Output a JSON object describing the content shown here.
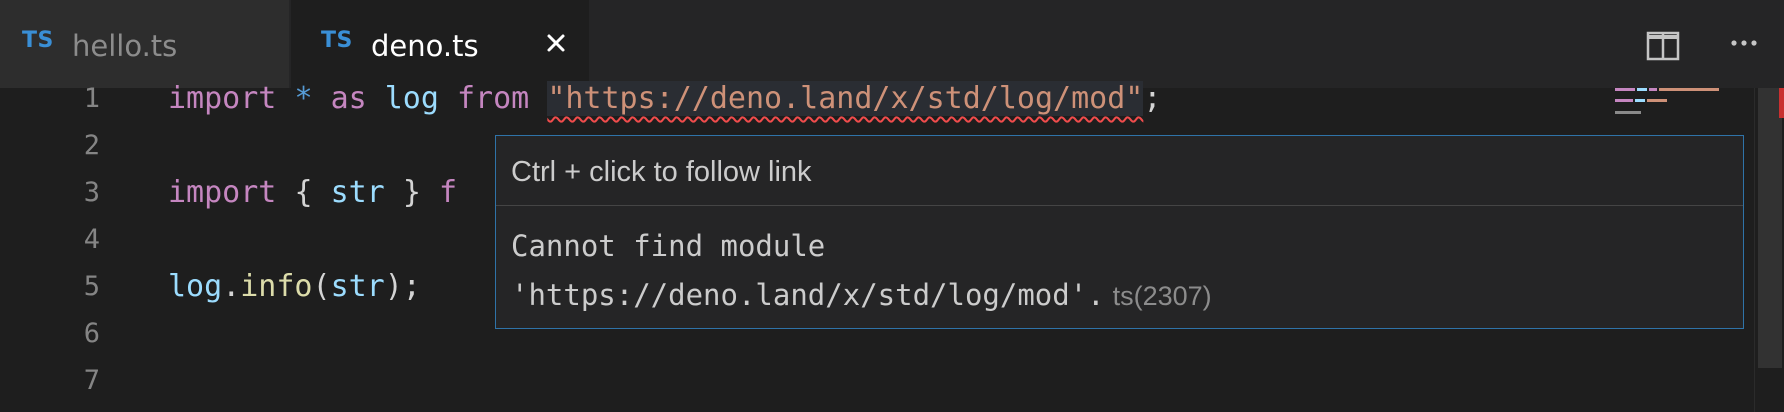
{
  "tabs": [
    {
      "lang": "TS",
      "name": "hello.ts",
      "active": false
    },
    {
      "lang": "TS",
      "name": "deno.ts",
      "active": true
    }
  ],
  "tabbar_actions": {
    "split": "split-editor-icon",
    "more": "more-actions-icon"
  },
  "editor": {
    "lines": [
      {
        "number": "1",
        "tokens": [
          {
            "t": "import",
            "c": "kw"
          },
          {
            "t": " ",
            "c": "punc"
          },
          {
            "t": "*",
            "c": "op"
          },
          {
            "t": " ",
            "c": "punc"
          },
          {
            "t": "as",
            "c": "kw"
          },
          {
            "t": " ",
            "c": "punc"
          },
          {
            "t": "log",
            "c": "var"
          },
          {
            "t": " ",
            "c": "punc"
          },
          {
            "t": "from",
            "c": "kw"
          },
          {
            "t": " ",
            "c": "punc"
          },
          {
            "t": "\"https://deno.land/x/std/log/mod\"",
            "c": "str"
          },
          {
            "t": ";",
            "c": "punc"
          }
        ]
      },
      {
        "number": "2",
        "tokens": []
      },
      {
        "number": "3",
        "tokens": [
          {
            "t": "import",
            "c": "kw"
          },
          {
            "t": " ",
            "c": "punc"
          },
          {
            "t": "{",
            "c": "punc"
          },
          {
            "t": " ",
            "c": "punc"
          },
          {
            "t": "str",
            "c": "var"
          },
          {
            "t": " ",
            "c": "punc"
          },
          {
            "t": "}",
            "c": "punc"
          },
          {
            "t": " ",
            "c": "punc"
          },
          {
            "t": "f",
            "c": "kw"
          }
        ]
      },
      {
        "number": "4",
        "tokens": []
      },
      {
        "number": "5",
        "tokens": [
          {
            "t": "log",
            "c": "var"
          },
          {
            "t": ".",
            "c": "punc"
          },
          {
            "t": "info",
            "c": "fn"
          },
          {
            "t": "(",
            "c": "punc"
          },
          {
            "t": "str",
            "c": "var"
          },
          {
            "t": ");",
            "c": "punc"
          }
        ]
      },
      {
        "number": "6",
        "tokens": []
      },
      {
        "number": "7",
        "tokens": []
      }
    ]
  },
  "hover": {
    "link_hint": "Ctrl + click to follow link",
    "message_line1": "Cannot find module",
    "message_line2": "'https://deno.land/x/std/log/mod'.",
    "code": "ts(2307)"
  },
  "colors": {
    "keyword": "#c586c0",
    "operator": "#569cd6",
    "variable": "#9cdcfe",
    "function": "#dcdcaa",
    "string": "#ce9178",
    "error_squiggle": "#f14c4c",
    "hover_border": "#2f73a8",
    "tab_lang": "#3a8fd6"
  }
}
